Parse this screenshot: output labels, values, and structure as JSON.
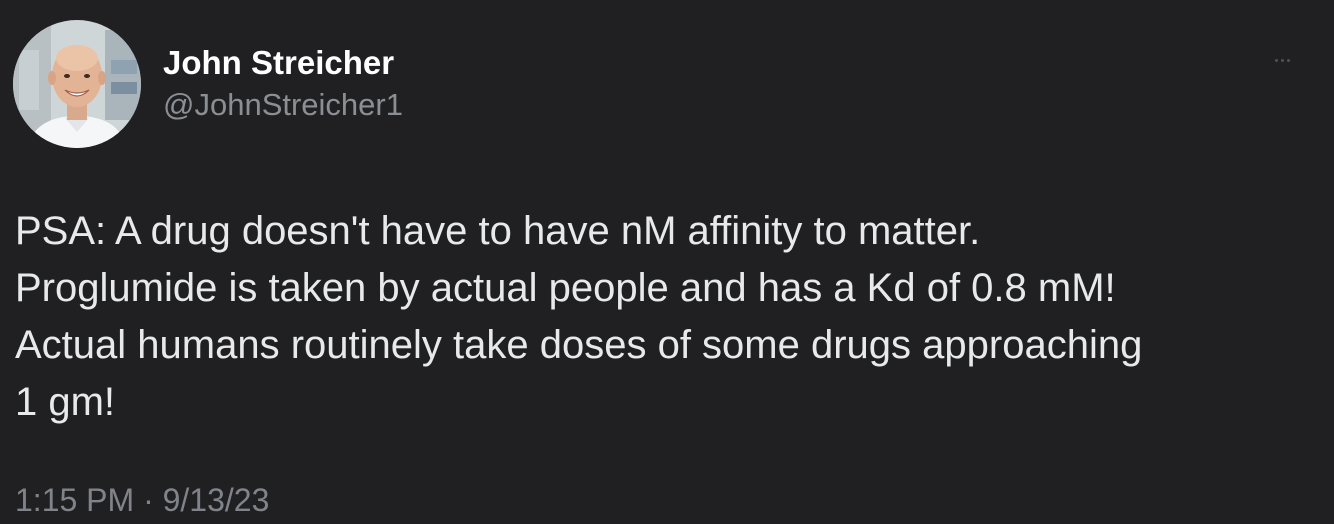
{
  "author": {
    "display_name": "John Streicher",
    "handle": "@JohnStreicher1"
  },
  "more_icon": "ellipsis-icon",
  "tweet": {
    "text": "PSA: A drug doesn't have to have nM affinity to matter.\nProglumide is taken by actual people and has a Kd of 0.8 mM!\nActual humans routinely take doses of some drugs approaching\n1 gm!",
    "time": "1:15 PM",
    "separator": "·",
    "date": "9/13/23"
  },
  "colors": {
    "background": "#202023",
    "text": "#e7e9ea",
    "secondary": "#8b8f94"
  }
}
